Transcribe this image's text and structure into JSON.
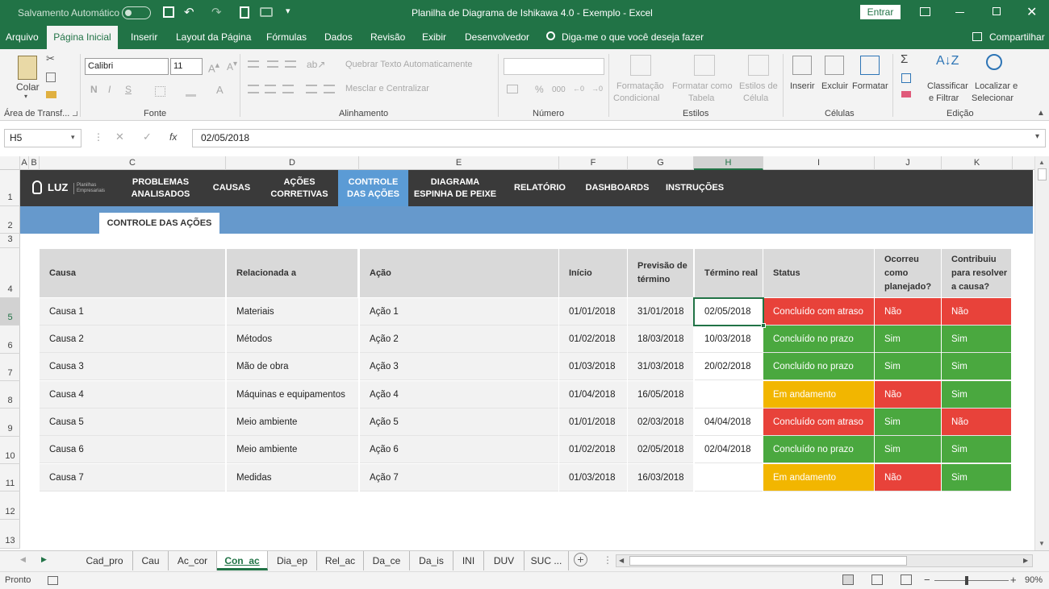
{
  "window": {
    "autosave_label": "Salvamento Automático",
    "autosave_state": "off",
    "title": "Planilha de Diagrama de Ishikawa 4.0 - Exemplo  -  Excel",
    "signin_label": "Entrar"
  },
  "ribbon_tabs": [
    "Arquivo",
    "Página Inicial",
    "Inserir",
    "Layout da Página",
    "Fórmulas",
    "Dados",
    "Revisão",
    "Exibir",
    "Desenvolvedor"
  ],
  "active_ribbon_tab": "Página Inicial",
  "tell_me": "Diga-me o que você deseja fazer",
  "share_label": "Compartilhar",
  "ribbon": {
    "paste_label": "Colar",
    "clipboard_group": "Área de Transf...",
    "font_name": "Calibri",
    "font_size": "11",
    "font_group": "Fonte",
    "wrap_text": "Quebrar Texto Automaticamente",
    "merge_center": "Mesclar e Centralizar",
    "alignment_group": "Alinhamento",
    "number_format_value": "",
    "number_group": "Número",
    "conditional_format_1": "Formatação",
    "conditional_format_2": "Condicional",
    "format_table_1": "Formatar como",
    "format_table_2": "Tabela",
    "cell_styles_1": "Estilos de",
    "cell_styles_2": "Célula",
    "styles_group": "Estilos",
    "insert_label": "Inserir",
    "delete_label": "Excluir",
    "format_label": "Formatar",
    "cells_group": "Células",
    "sort_filter_1": "Classificar",
    "sort_filter_2": "e Filtrar",
    "find_select_1": "Localizar e",
    "find_select_2": "Selecionar",
    "editing_group": "Edição",
    "bold": "N",
    "italic": "I",
    "underline": "S",
    "percent": "%",
    "thousands": "000"
  },
  "formula_bar": {
    "name_box": "H5",
    "fx": "fx",
    "value": "02/05/2018"
  },
  "columns": [
    "A",
    "B",
    "C",
    "D",
    "E",
    "F",
    "G",
    "H",
    "I",
    "J",
    "K"
  ],
  "selected_column": "H",
  "rows": [
    "1",
    "2",
    "3",
    "4",
    "5",
    "6",
    "7",
    "8",
    "9",
    "10",
    "11",
    "12",
    "13"
  ],
  "selected_row": "5",
  "nav": {
    "logo": "LUZ",
    "logo_sub": "Planilhas Empresariais",
    "items": [
      "PROBLEMAS ANALISADOS",
      "CAUSAS",
      "AÇÕES CORRETIVAS",
      "CONTROLE DAS AÇÕES",
      "DIAGRAMA ESPINHA DE PEIXE",
      "RELATÓRIO",
      "DASHBOARDS",
      "INSTRUÇÕES"
    ],
    "active": "CONTROLE DAS AÇÕES"
  },
  "section_tab": "CONTROLE DAS AÇÕES",
  "table": {
    "headers": [
      "Causa",
      "Relacionada a",
      "Ação",
      "Início",
      "Previsão de término",
      "Término real",
      "Status",
      "Ocorreu como planejado?",
      "Contribuiu para resolver a causa?"
    ],
    "rows": [
      [
        "Causa 1",
        "Materiais",
        "Ação 1",
        "01/01/2018",
        "31/01/2018",
        "02/05/2018",
        "Concluído com atraso",
        "Não",
        "Não"
      ],
      [
        "Causa 2",
        "Métodos",
        "Ação 2",
        "01/02/2018",
        "18/03/2018",
        "10/03/2018",
        "Concluído no prazo",
        "Sim",
        "Sim"
      ],
      [
        "Causa 3",
        "Mão de obra",
        "Ação 3",
        "01/03/2018",
        "31/03/2018",
        "20/02/2018",
        "Concluído no prazo",
        "Sim",
        "Sim"
      ],
      [
        "Causa 4",
        "Máquinas e equipamentos",
        "Ação 4",
        "01/04/2018",
        "16/05/2018",
        "",
        "Em andamento",
        "Não",
        "Sim"
      ],
      [
        "Causa 5",
        "Meio ambiente",
        "Ação 5",
        "01/01/2018",
        "02/03/2018",
        "04/04/2018",
        "Concluído com atraso",
        "Sim",
        "Não"
      ],
      [
        "Causa 6",
        "Meio ambiente",
        "Ação 6",
        "01/02/2018",
        "02/05/2018",
        "02/04/2018",
        "Concluído no prazo",
        "Sim",
        "Sim"
      ],
      [
        "Causa 7",
        "Medidas",
        "Ação 7",
        "01/03/2018",
        "16/03/2018",
        "",
        "Em andamento",
        "Não",
        "Sim"
      ]
    ],
    "colors": {
      "red": "#e8423a",
      "green": "#4aa83f",
      "yellow": "#f2b600"
    }
  },
  "sheet_tabs": [
    "Cad_pro",
    "Cau",
    "Ac_cor",
    "Con_ac",
    "Dia_ep",
    "Rel_ac",
    "Da_ce",
    "Da_is",
    "INI",
    "DUV",
    "SUC ..."
  ],
  "active_sheet": "Con_ac",
  "status": {
    "ready": "Pronto",
    "zoom": "90%"
  }
}
